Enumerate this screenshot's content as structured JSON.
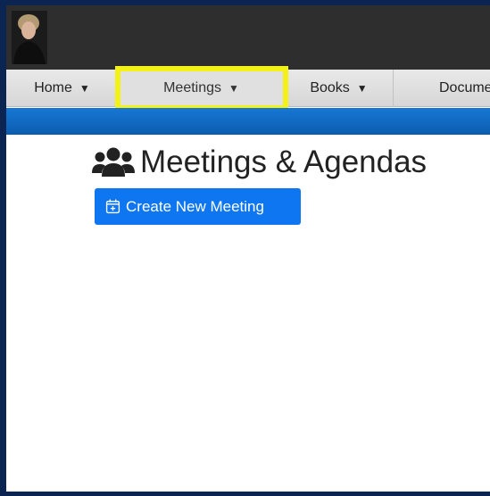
{
  "nav": {
    "items": [
      {
        "label": "Home",
        "caret": "▼"
      },
      {
        "label": "Meetings",
        "caret": "▼"
      },
      {
        "label": "Books",
        "caret": "▼"
      },
      {
        "label": "Docume"
      }
    ]
  },
  "page": {
    "title": "Meetings & Agendas",
    "title_icon": "users-icon"
  },
  "actions": {
    "create_label": "Create New Meeting",
    "create_icon": "calendar-plus-icon"
  },
  "colors": {
    "frame": "#0c2452",
    "topbar": "#2e2e2e",
    "accent_blue": "#0d76f0",
    "highlight": "#f4f116"
  }
}
